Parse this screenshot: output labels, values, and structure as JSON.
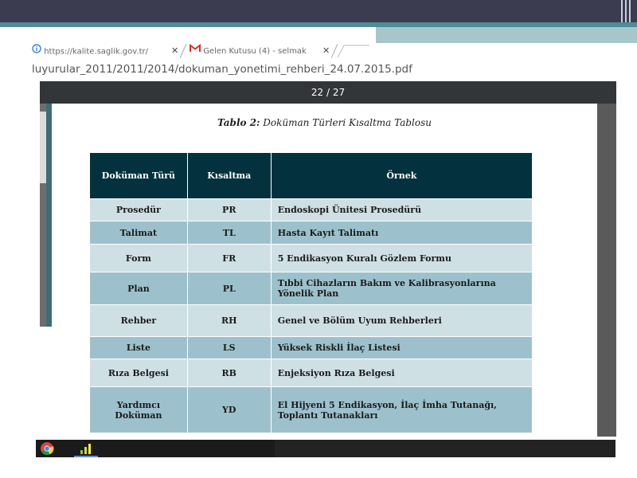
{
  "browser": {
    "tabs": [
      {
        "icon": "info-icon",
        "label": "https://kalite.saglik.gov.tr/"
      },
      {
        "icon": "gmail-icon",
        "label": "Gelen Kutusu (4) - selmak"
      }
    ],
    "url": "luyurular_2011/2011/2014/dokuman_yonetimi_rehberi_24.07.2015.pdf"
  },
  "viewer": {
    "page_counter": "22 / 27"
  },
  "document": {
    "caption_label": "Tablo 2:",
    "caption_text": "Doküman Türleri Kısaltma Tablosu",
    "headers": [
      "Doküman Türü",
      "Kısaltma",
      "Örnek"
    ],
    "rows": [
      [
        "Prosedür",
        "PR",
        "Endoskopi Ünitesi Prosedürü"
      ],
      [
        "Talimat",
        "TL",
        "Hasta Kayıt Talimatı"
      ],
      [
        "Form",
        "FR",
        "5 Endikasyon Kuralı Gözlem Formu"
      ],
      [
        "Plan",
        "PL",
        "Tıbbi Cihazların Bakım ve Kalibrasyonlarına Yönelik Plan"
      ],
      [
        "Rehber",
        "RH",
        "Genel ve Bölüm Uyum Rehberleri"
      ],
      [
        "Liste",
        "LS",
        "Yüksek Riskli İlaç Listesi"
      ],
      [
        "Rıza Belgesi",
        "RB",
        "Enjeksiyon Rıza Belgesi"
      ],
      [
        "Yardımcı Doküman",
        "YD",
        "El Hijyeni 5 Endikasyon, İlaç İmha Tutanağı, Toplantı Tutanakları"
      ]
    ]
  },
  "taskbar": {
    "apps": [
      "chrome-icon",
      "app-icon"
    ]
  },
  "colors": {
    "header_bg": "#03323e",
    "row_light": "#cfe0e5",
    "row_dark": "#9dc1cc",
    "slide_top": "#3c3c50",
    "slide_teal": "#4e8c96"
  }
}
